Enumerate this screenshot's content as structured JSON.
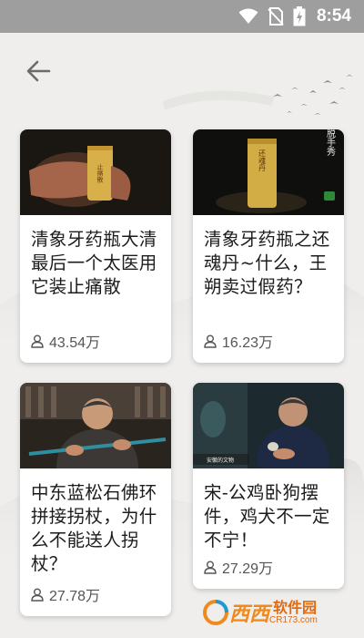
{
  "status_bar": {
    "time": "8:54",
    "icons": [
      "wifi-icon",
      "no-sim-icon",
      "battery-charging-icon"
    ]
  },
  "header": {
    "back_icon": "arrow-left-icon"
  },
  "cards": [
    {
      "title": "清象牙药瓶大清最后一个太医用它装止痛散",
      "views": "43.54万",
      "view_icon": "person-icon",
      "thumb_text": "止痛散"
    },
    {
      "title": "清象牙药瓶之还魂丹~什么，王朔卖过假药？",
      "views": "16.23万",
      "view_icon": "person-icon",
      "thumb_text": "还魂丹",
      "thumb_side_text": "脱手秀"
    },
    {
      "title": "中东蓝松石佛环拼接拐杖，为什么不能送人拐杖？",
      "views": "27.78万",
      "view_icon": "person-icon"
    },
    {
      "title": "宋-公鸡卧狗摆件，鸡犬不一定不宁！",
      "views": "27.29万",
      "view_icon": "person-icon",
      "thumb_caption": "安徽的文物"
    }
  ],
  "watermark": {
    "brand": "西西",
    "sub": "软件园",
    "url": "CR173.com"
  },
  "colors": {
    "status_bar": "#9e9e9e",
    "background": "#efeeec",
    "card": "#ffffff",
    "title_text": "#1c1c1c",
    "meta_text": "#555555"
  }
}
